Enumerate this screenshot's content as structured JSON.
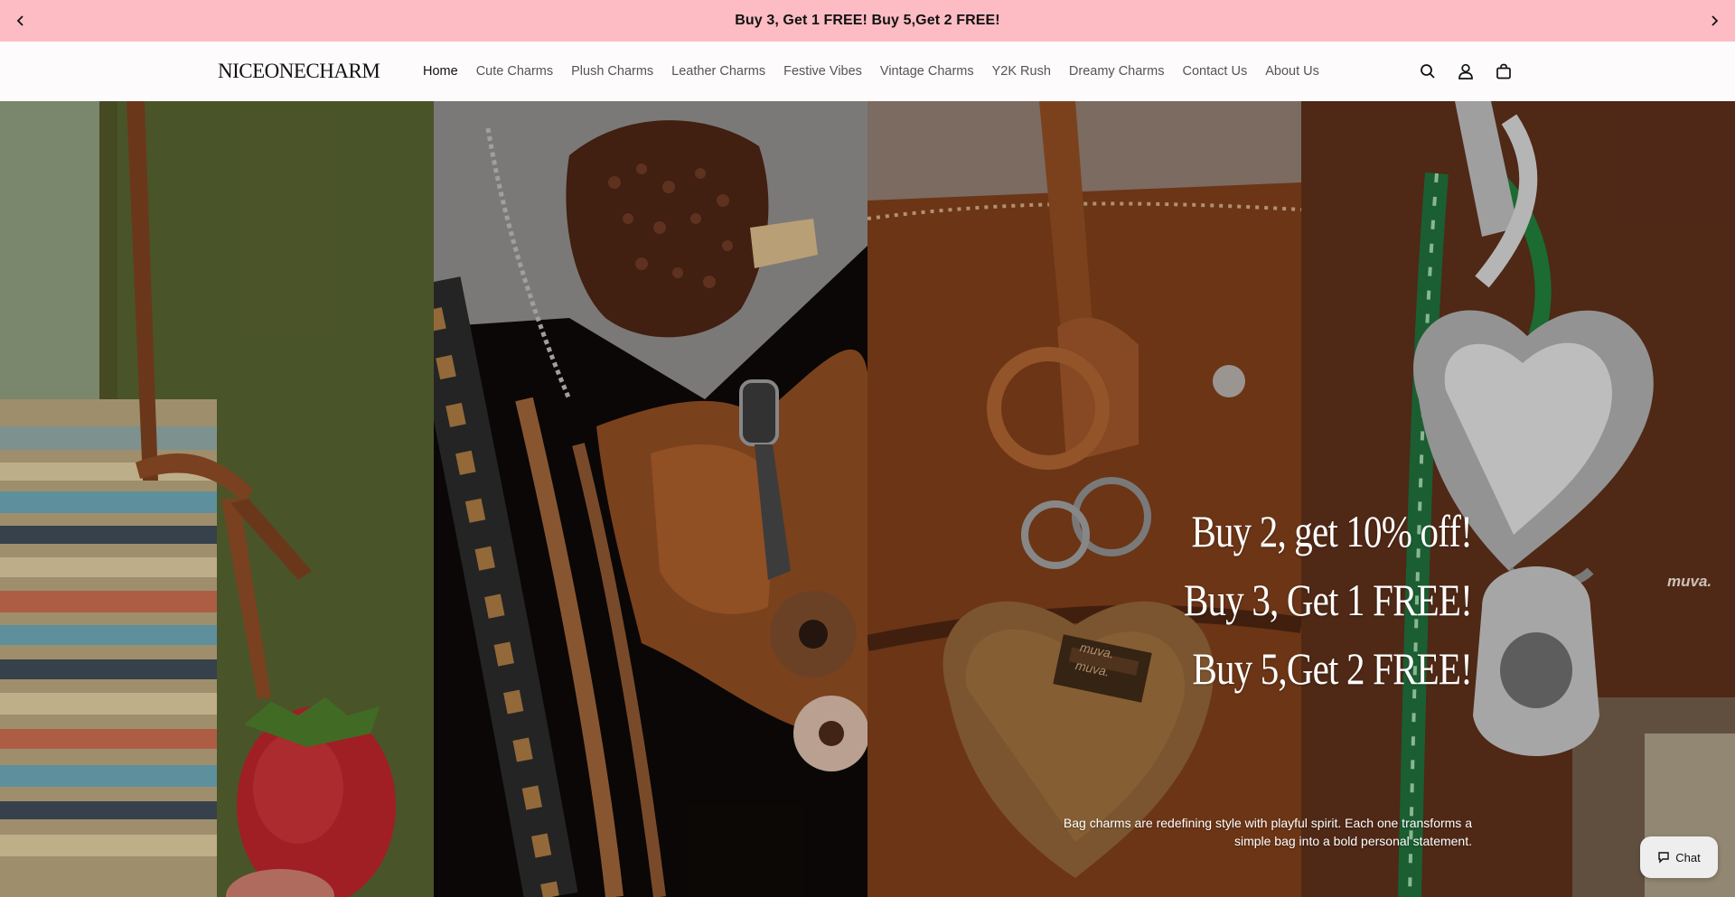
{
  "announcement": {
    "text": "Buy 3, Get 1 FREE! Buy 5,Get 2 FREE!",
    "prev_icon": "chevron-left-icon",
    "next_icon": "chevron-right-icon",
    "background": "#fdbcc4"
  },
  "header": {
    "logo": "NICEONECHARM",
    "nav": [
      {
        "label": "Home",
        "active": true
      },
      {
        "label": "Cute Charms"
      },
      {
        "label": "Plush Charms"
      },
      {
        "label": "Leather Charms"
      },
      {
        "label": "Festive Vibes"
      },
      {
        "label": "Vintage Charms"
      },
      {
        "label": "Y2K Rush"
      },
      {
        "label": "Dreamy Charms"
      },
      {
        "label": "Contact Us"
      },
      {
        "label": "About Us"
      }
    ],
    "icons": [
      "search-icon",
      "account-icon",
      "cart-icon"
    ]
  },
  "hero": {
    "promo_lines": [
      "Buy 2, get 10% off!",
      "Buy 3, Get 1 FREE!",
      "Buy 5,Get 2 FREE!"
    ],
    "description": "Bag charms are redefining style with playful spirit. Each one transforms a simple bag into a bold personal statement.",
    "panel_labels": {
      "plush_tag_line1": "muva.",
      "plush_tag_line2": "muva.",
      "metal_charm_brand": "muva."
    }
  },
  "chat": {
    "label": "Chat",
    "icon": "chat-bubble-icon"
  }
}
